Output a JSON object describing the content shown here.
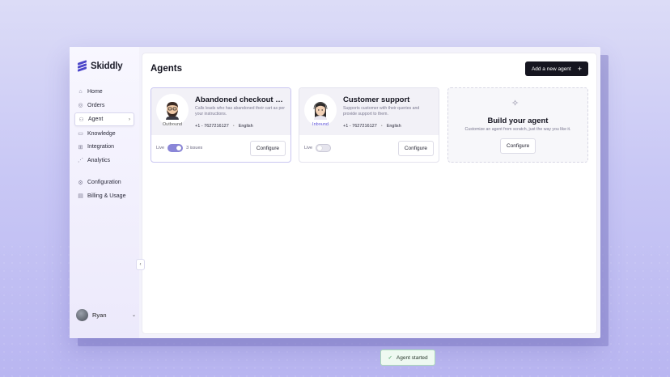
{
  "app": {
    "name": "Skiddly"
  },
  "sidebar": {
    "items": [
      {
        "label": "Home",
        "icon": "home-icon"
      },
      {
        "label": "Orders",
        "icon": "orders-icon"
      },
      {
        "label": "Agent",
        "icon": "user-icon",
        "active": true
      },
      {
        "label": "Knowledge",
        "icon": "book-icon"
      },
      {
        "label": "Integration",
        "icon": "grid-icon"
      },
      {
        "label": "Analytics",
        "icon": "chart-icon"
      }
    ],
    "secondary": [
      {
        "label": "Configuration",
        "icon": "gear-icon"
      },
      {
        "label": "Billing & Usage",
        "icon": "billing-icon"
      }
    ],
    "user": {
      "name": "Ryan"
    }
  },
  "main": {
    "title": "Agents",
    "add_button": "Add a new agent",
    "cards": [
      {
        "name": "Abandoned checkout agent",
        "direction": "Outbound",
        "description": "Calls leads who has abandoned their cart as per your instructions.",
        "phone": "+1 - 7627216127",
        "language": "English",
        "live_label": "Live",
        "live": true,
        "issues": "3 issues",
        "configure": "Configure"
      },
      {
        "name": "Customer support",
        "direction": "Inbound",
        "description": "Supports customer with their queries and provide support to them.",
        "phone": "+1 - 7627216127",
        "language": "English",
        "live_label": "Live",
        "live": false,
        "configure": "Configure"
      }
    ],
    "build": {
      "title": "Build your agent",
      "description": "Customize an agent from scratch, just the way you like it.",
      "configure": "Configure"
    }
  },
  "toast": {
    "message": "Agent started"
  },
  "colors": {
    "accent": "#4b46c9",
    "toggle_on": "#8a86d8",
    "success": "#3a9a57"
  }
}
